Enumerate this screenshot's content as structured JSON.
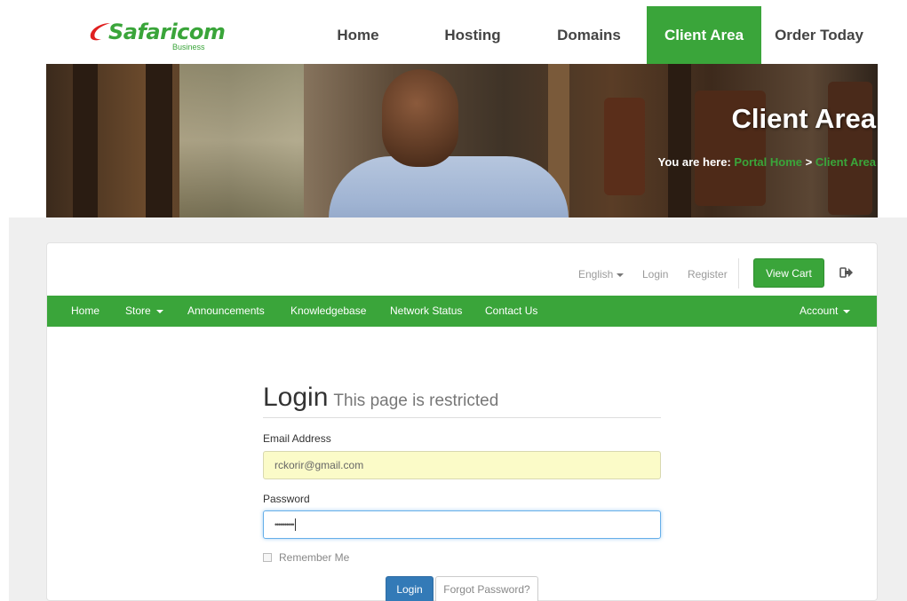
{
  "brand": {
    "name": "Safaricom",
    "sub": "Business",
    "color": "#3aa53a"
  },
  "topnav": {
    "items": [
      {
        "label": "Home"
      },
      {
        "label": "Hosting"
      },
      {
        "label": "Domains"
      },
      {
        "label": "Client Area",
        "active": true
      },
      {
        "label": "Order Today"
      }
    ]
  },
  "hero": {
    "title": "Client Area",
    "breadcrumb_prefix": "You are here:",
    "breadcrumb_home": "Portal Home",
    "breadcrumb_sep": ">",
    "breadcrumb_current": "Client Area"
  },
  "util": {
    "language": "English",
    "login": "Login",
    "register": "Register",
    "view_cart": "View Cart",
    "logout_icon": "sign-out-icon"
  },
  "mainnav": {
    "home": "Home",
    "store": "Store",
    "announcements": "Announcements",
    "knowledgebase": "Knowledgebase",
    "network_status": "Network Status",
    "contact_us": "Contact Us",
    "account": "Account"
  },
  "login": {
    "title": "Login",
    "subtitle": "This page is restricted",
    "email_label": "Email Address",
    "email_value": "rckorir@gmail.com",
    "password_label": "Password",
    "password_value": "••••••••••",
    "remember_label": "Remember Me",
    "login_button": "Login",
    "forgot_button": "Forgot Password?"
  },
  "colors": {
    "accent": "#3aa53a",
    "primary_button": "#337ab7"
  }
}
